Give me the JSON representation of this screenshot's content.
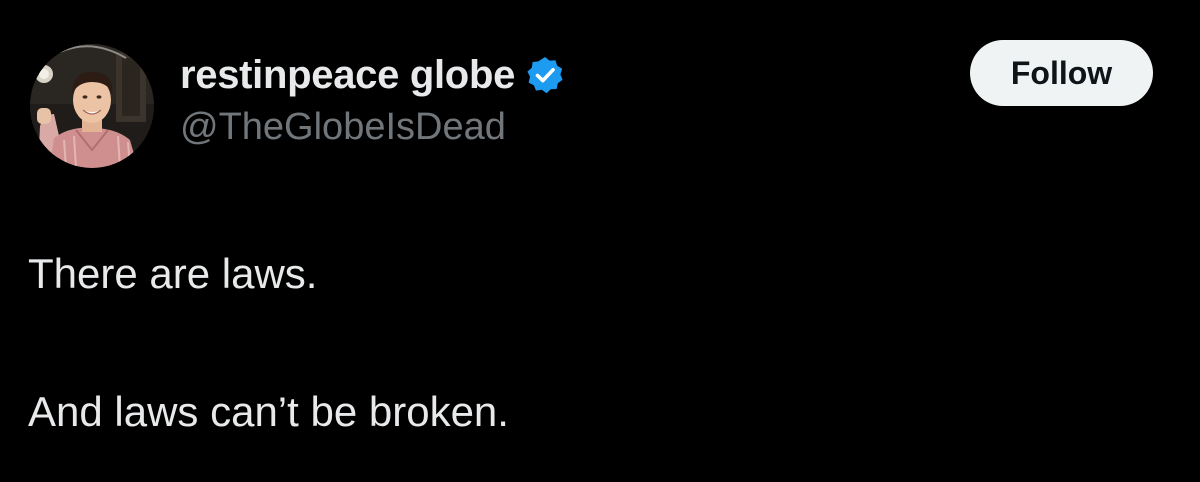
{
  "author": {
    "display_name": "restinpeace globe",
    "handle": "@TheGlobeIsDead",
    "verified": true,
    "verified_color": "#1d9bf0",
    "avatar_icon": "profile-photo"
  },
  "follow_button": {
    "label": "Follow"
  },
  "tweet": {
    "lines": [
      "There are laws.",
      "And laws can’t be broken."
    ]
  },
  "colors": {
    "background": "#000000",
    "text_primary": "#e7e9ea",
    "text_secondary": "#71767b",
    "button_bg": "#eff3f4",
    "button_text": "#0f1419"
  }
}
